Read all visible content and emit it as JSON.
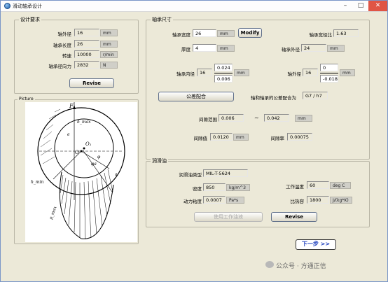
{
  "window": {
    "title": "滑动轴承设计"
  },
  "design_req": {
    "title": "设计要求",
    "rows": [
      {
        "label": "轴外径",
        "value": "16",
        "unit": "mm"
      },
      {
        "label": "轴承长度",
        "value": "26",
        "unit": "mm"
      },
      {
        "label": "转速",
        "value": "10000",
        "unit": "r/min"
      },
      {
        "label": "轴承径向力",
        "value": "2832",
        "unit": "N"
      }
    ],
    "revise": "Revise"
  },
  "picture": {
    "title": "Picture",
    "labels": {
      "F": "F",
      "e": "e",
      "O": "O",
      "O1": "O₁",
      "hmin": "h_min",
      "hmax": "h_max",
      "phi": "φ",
      "phia": "φa",
      "pmax": "p_max",
      "a": "a",
      "theta": "θ"
    }
  },
  "bearing": {
    "title": "轴承尺寸",
    "width_label": "轴承宽度",
    "width_value": "26",
    "width_unit": "mm",
    "modify": "Modify",
    "ratio_label": "轴承宽径比",
    "ratio_value": "1.63",
    "thick_label": "厚度",
    "thick_value": "4",
    "thick_unit": "mm",
    "outer_label": "轴承外径",
    "outer_value": "24",
    "outer_unit": "mm",
    "inner_label": "轴承内径",
    "inner_value": "16",
    "inner_upper": "0.024",
    "inner_lower": "0.006",
    "inner_unit": "mm",
    "shaft_label": "轴外径",
    "shaft_value": "16",
    "shaft_upper": "0",
    "shaft_lower": "-0.018",
    "shaft_unit": "mm",
    "fit_button": "公差配合",
    "fit_label": "轴和轴承的公差配合为",
    "fit_value": "G7 / h7",
    "gap_range_label": "间隙范围",
    "gap_min": "0.006",
    "gap_tilde": "~",
    "gap_max": "0.042",
    "gap_unit": "mm",
    "gap_label": "间隙值",
    "gap_value": "0.0120",
    "gap_value_unit": "mm",
    "gap_ratio_label": "间隙率",
    "gap_ratio_value": "0.00075"
  },
  "lube": {
    "title": "润滑油",
    "type_label": "润滑油类型",
    "type_value": "MIL-T-5624",
    "density_label": "密度",
    "density_value": "850",
    "density_unit": "kg/m^3",
    "temp_label": "工作温度",
    "temp_value": "60",
    "temp_unit": "deg C",
    "visc_label": "动力粘度",
    "visc_value": "0.0007",
    "visc_unit": "Pa*s",
    "heat_label": "比热容",
    "heat_value": "1800",
    "heat_unit": "J/(kg*K)",
    "use_btn": "使用工作油液",
    "revise": "Revise"
  },
  "next_btn": "下一步 >>",
  "watermark": "公众号 · 方通正信"
}
